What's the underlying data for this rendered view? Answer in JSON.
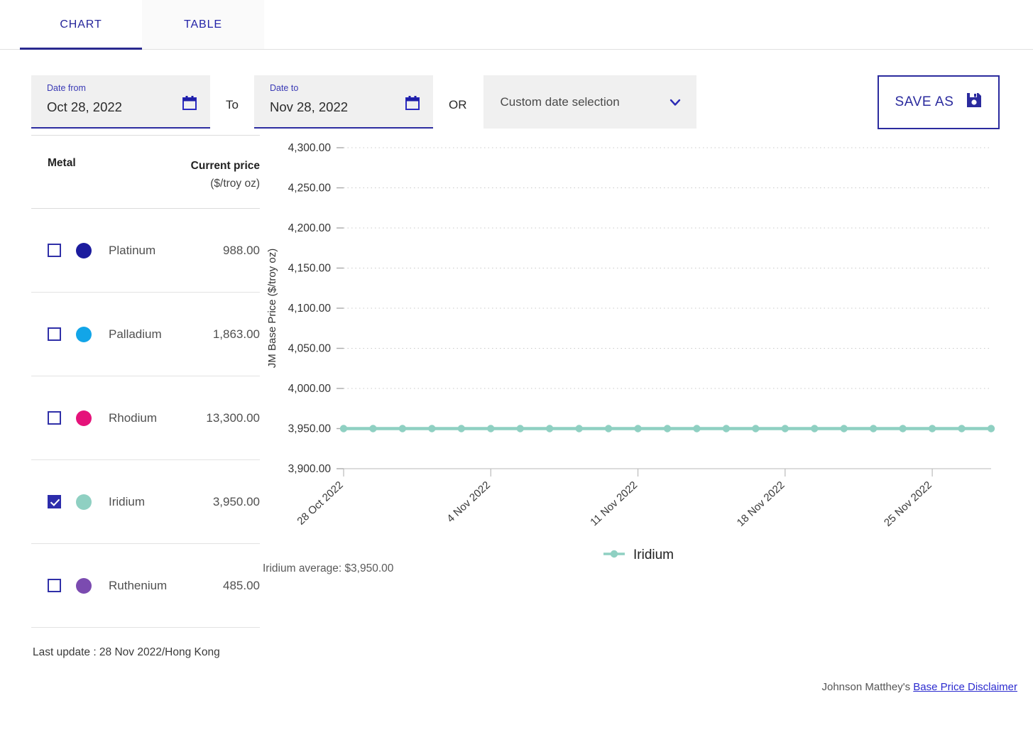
{
  "tabs": [
    {
      "label": "CHART",
      "active": true
    },
    {
      "label": "TABLE",
      "active": false
    }
  ],
  "controls": {
    "date_from": {
      "label": "Date from",
      "value": "Oct 28, 2022",
      "icon": "calendar-icon"
    },
    "to_separator": "To",
    "date_to": {
      "label": "Date to",
      "value": "Nov 28, 2022",
      "icon": "calendar-icon"
    },
    "or_separator": "OR",
    "custom_select": {
      "value": "Custom date selection",
      "icon": "chevron-down-icon"
    },
    "save_as": {
      "label": "SAVE AS",
      "icon": "floppy-disk-icon"
    }
  },
  "metal_table": {
    "header": {
      "metal": "Metal",
      "price_line1": "Current price",
      "price_line2": "($/troy oz)"
    },
    "rows": [
      {
        "name": "Platinum",
        "price": "988.00",
        "color": "#1c1c9e",
        "checked": false
      },
      {
        "name": "Palladium",
        "price": "1,863.00",
        "color": "#12a5e8",
        "checked": false
      },
      {
        "name": "Rhodium",
        "price": "13,300.00",
        "color": "#e5137a",
        "checked": false
      },
      {
        "name": "Iridium",
        "price": "3,950.00",
        "color": "#8fd0c2",
        "checked": true
      },
      {
        "name": "Ruthenium",
        "price": "485.00",
        "color": "#7b4bb0",
        "checked": false
      }
    ]
  },
  "last_update": "Last update : 28 Nov 2022/Hong Kong",
  "chart_average": "Iridium average: $3,950.00",
  "disclaimer": {
    "prefix": "Johnson Matthey's",
    "link": "Base Price Disclaimer"
  },
  "chart_data": {
    "type": "line",
    "title": "",
    "xlabel": "",
    "ylabel": "JM Base Price ($/troy oz)",
    "ylim": [
      3900,
      4300
    ],
    "yticks": [
      "3,900.00",
      "3,950.00",
      "4,000.00",
      "4,050.00",
      "4,100.00",
      "4,150.00",
      "4,200.00",
      "4,250.00",
      "4,300.00"
    ],
    "ytick_values": [
      3900,
      3950,
      4000,
      4050,
      4100,
      4150,
      4200,
      4250,
      4300
    ],
    "xticks": [
      "28 Oct 2022",
      "4 Nov 2022",
      "11 Nov 2022",
      "18 Nov 2022",
      "25 Nov 2022"
    ],
    "xtick_positions": [
      0,
      5,
      10,
      15,
      20
    ],
    "x": [
      0,
      1,
      2,
      3,
      4,
      5,
      6,
      7,
      8,
      9,
      10,
      11,
      12,
      13,
      14,
      15,
      16,
      17,
      18,
      19,
      20,
      21,
      22
    ],
    "grid": true,
    "legend_position": "bottom",
    "series": [
      {
        "name": "Iridium",
        "color": "#8fd0c2",
        "values": [
          3950,
          3950,
          3950,
          3950,
          3950,
          3950,
          3950,
          3950,
          3950,
          3950,
          3950,
          3950,
          3950,
          3950,
          3950,
          3950,
          3950,
          3950,
          3950,
          3950,
          3950,
          3950,
          3950
        ]
      }
    ],
    "legend": [
      {
        "label": "Iridium",
        "color": "#8fd0c2"
      }
    ]
  }
}
